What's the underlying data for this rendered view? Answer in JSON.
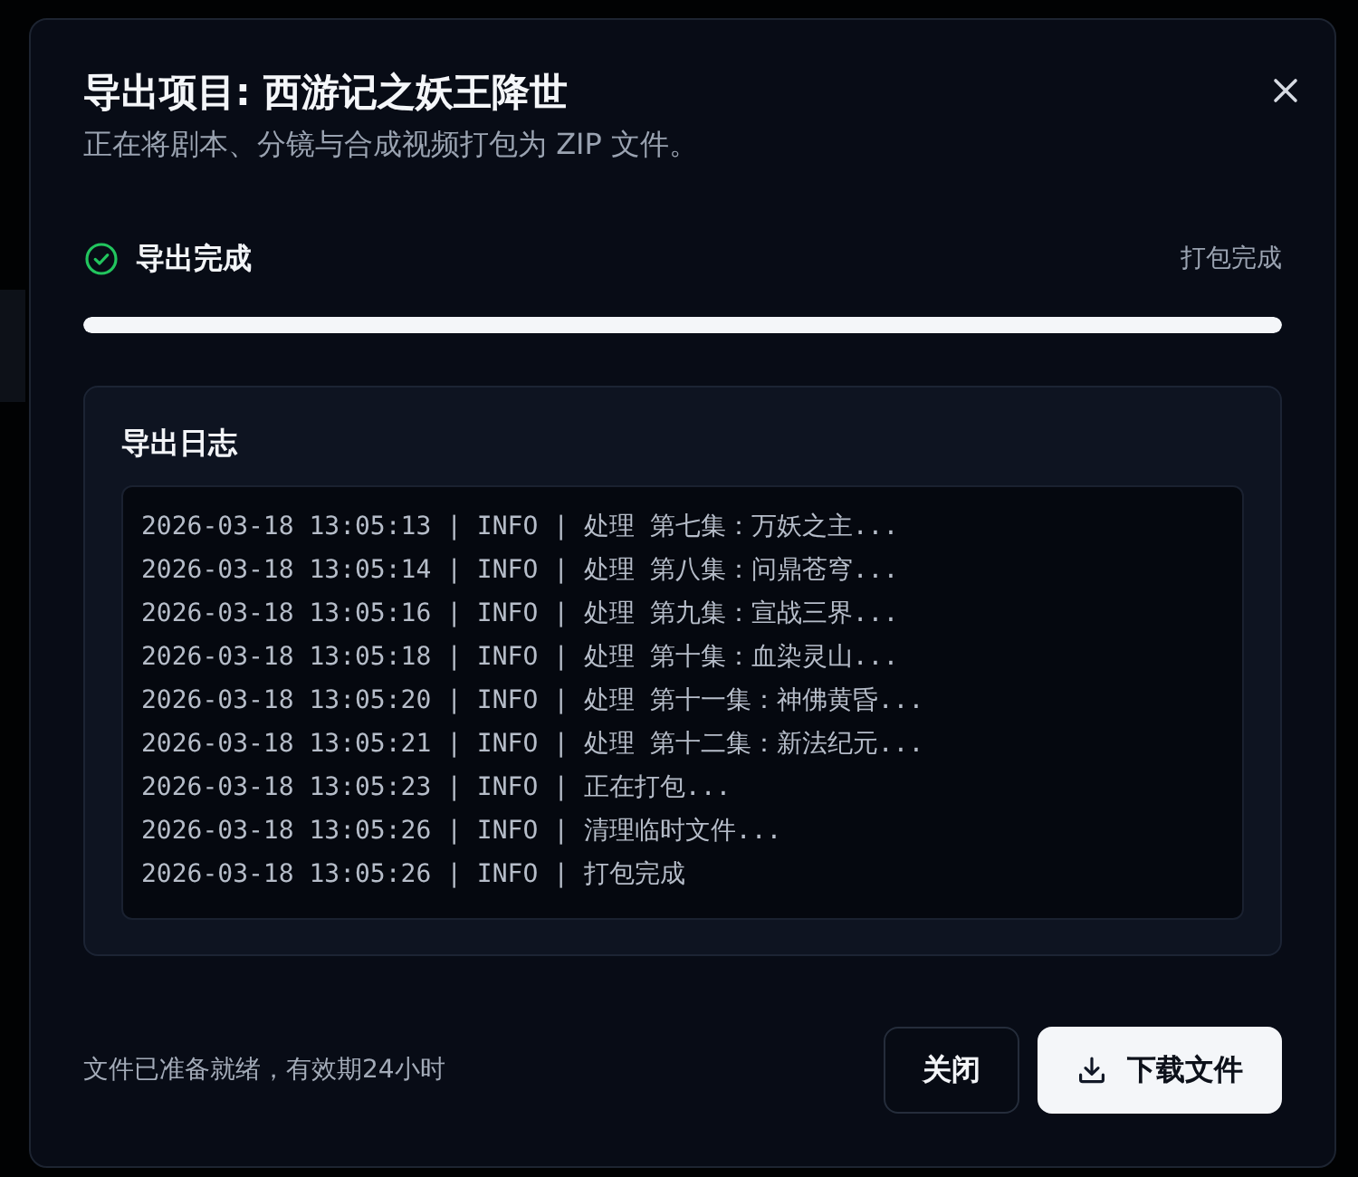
{
  "dialog": {
    "title": "导出项目: 西游记之妖王降世",
    "subtitle": "正在将剧本、分镜与合成视频打包为 ZIP 文件。"
  },
  "status": {
    "label": "导出完成",
    "complete": true,
    "detail": "打包完成"
  },
  "progress": {
    "level": 1
  },
  "log": {
    "title": "导出日志",
    "lines": [
      "2026-03-18 13:05:13 | INFO | 处理 第七集：万妖之主...",
      "2026-03-18 13:05:14 | INFO | 处理 第八集：问鼎苍穹...",
      "2026-03-18 13:05:16 | INFO | 处理 第九集：宣战三界...",
      "2026-03-18 13:05:18 | INFO | 处理 第十集：血染灵山...",
      "2026-03-18 13:05:20 | INFO | 处理 第十一集：神佛黄昏...",
      "2026-03-18 13:05:21 | INFO | 处理 第十二集：新法纪元...",
      "2026-03-18 13:05:23 | INFO | 正在打包...",
      "2026-03-18 13:05:26 | INFO | 清理临时文件...",
      "2026-03-18 13:05:26 | INFO | 打包完成"
    ]
  },
  "footer": {
    "note": "文件已准备就绪，有效期24小时",
    "buttons": [
      {
        "label": "关闭",
        "kind": "secondary"
      },
      {
        "label": "下载文件",
        "kind": "primary"
      }
    ]
  }
}
